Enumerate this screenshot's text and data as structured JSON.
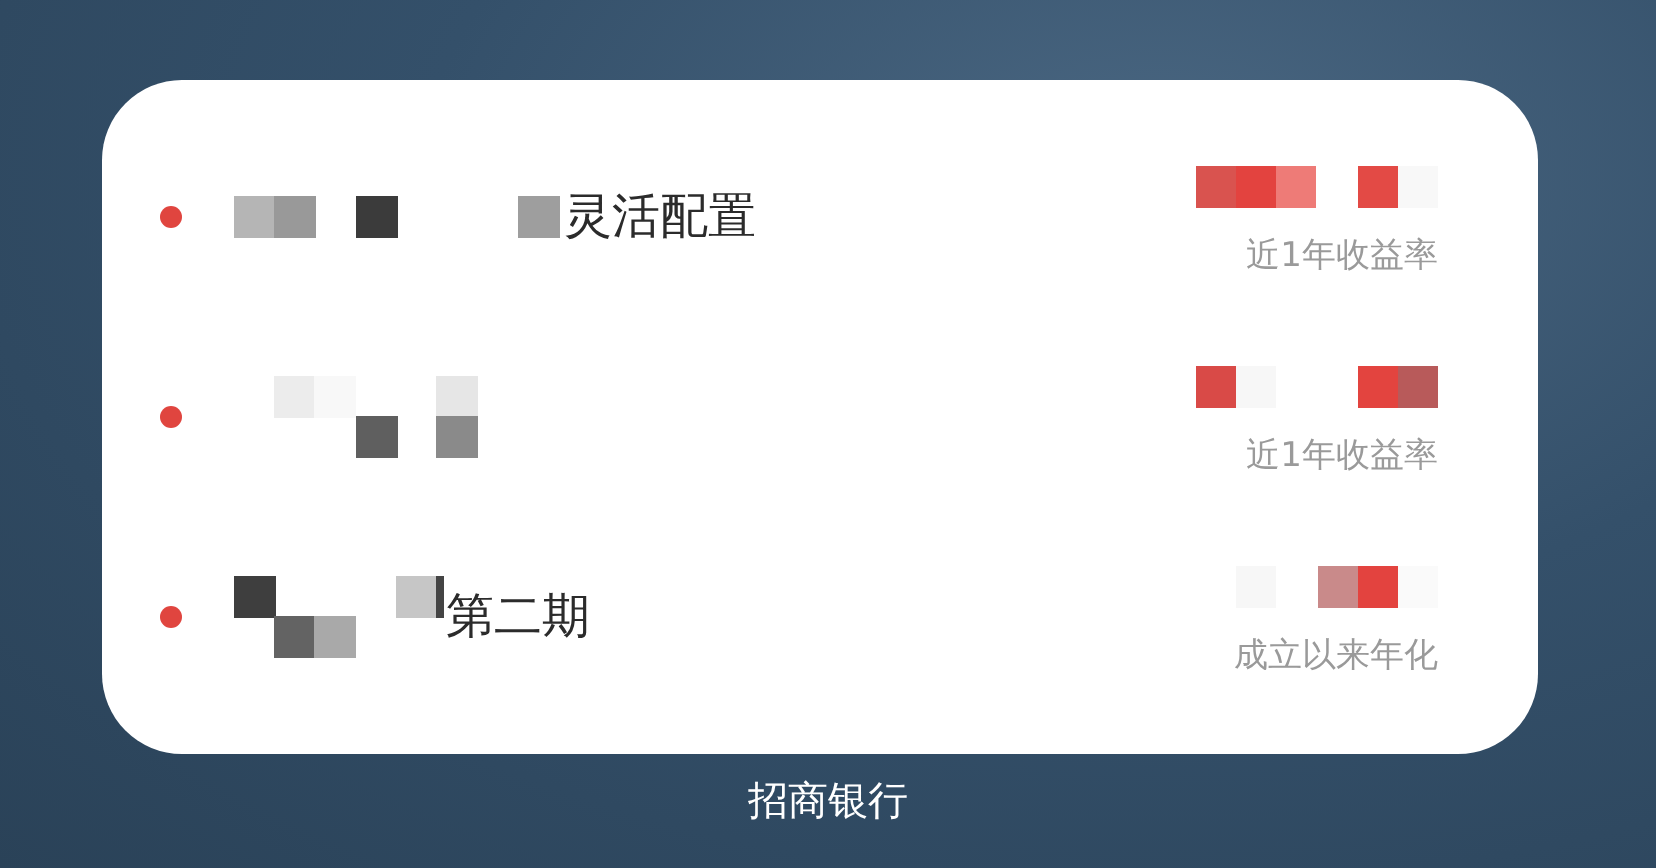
{
  "widget": {
    "rows": [
      {
        "title": "灵活配置",
        "caption": "近1年收益率"
      },
      {
        "caption": "近1年收益率"
      },
      {
        "title": "第二期",
        "caption": "成立以来年化"
      }
    ]
  },
  "bank_name": "招商银行"
}
